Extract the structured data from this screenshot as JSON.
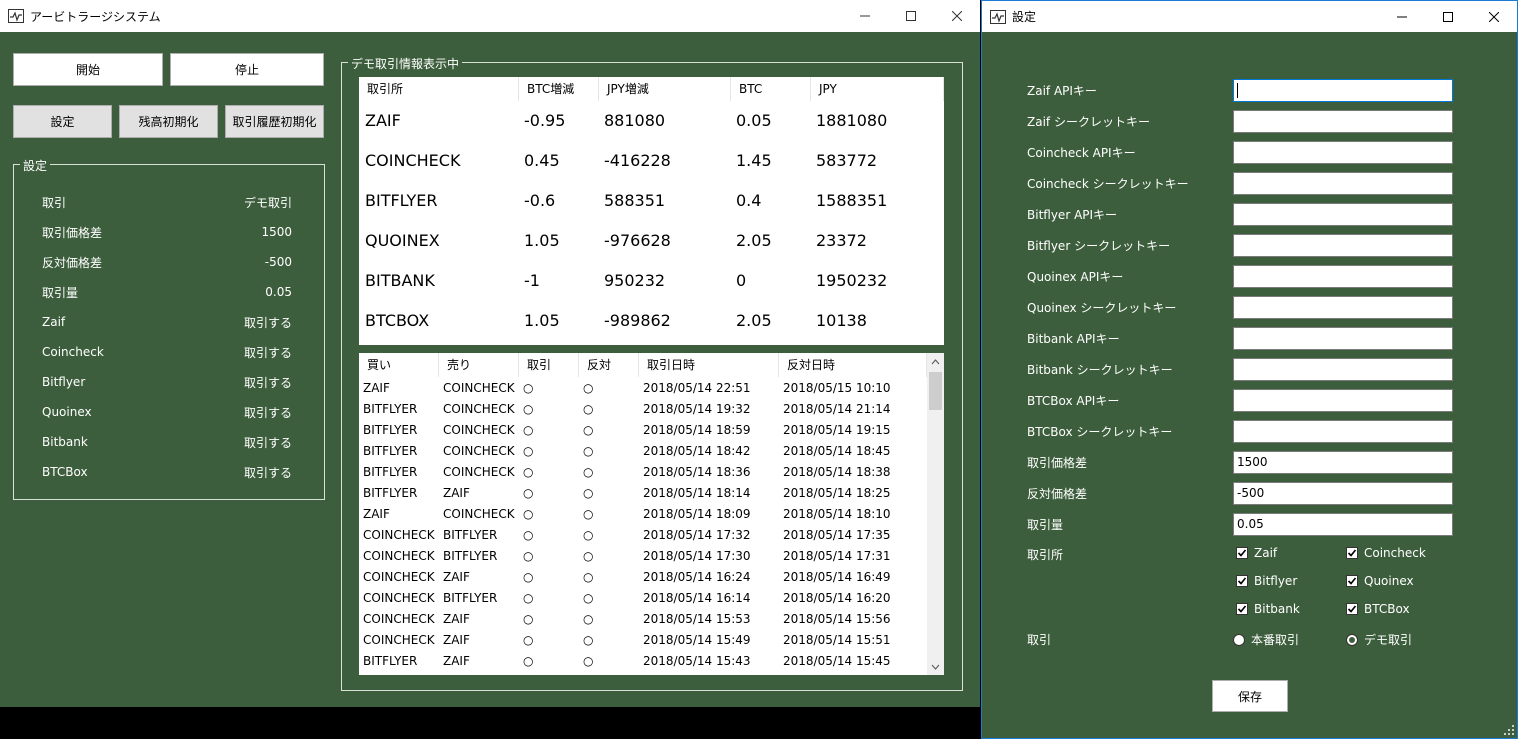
{
  "main_window": {
    "title": "アービトラージシステム",
    "buttons": {
      "start": "開始",
      "stop": "停止",
      "settings": "設定",
      "reset_balance": "残高初期化",
      "reset_history": "取引履歴初期化"
    },
    "settings_group": {
      "legend": "設定",
      "rows": [
        {
          "label": "取引",
          "value": "デモ取引"
        },
        {
          "label": "取引価格差",
          "value": "1500"
        },
        {
          "label": "反対価格差",
          "value": "-500"
        },
        {
          "label": "取引量",
          "value": "0.05"
        },
        {
          "label": "Zaif",
          "value": "取引する"
        },
        {
          "label": "Coincheck",
          "value": "取引する"
        },
        {
          "label": "Bitflyer",
          "value": "取引する"
        },
        {
          "label": "Quoinex",
          "value": "取引する"
        },
        {
          "label": "Bitbank",
          "value": "取引する"
        },
        {
          "label": "BTCBox",
          "value": "取引する"
        }
      ]
    },
    "info_group": {
      "legend": "デモ取引情報表示中",
      "exchange_headers": [
        "取引所",
        "BTC増減",
        "JPY増減",
        "BTC",
        "JPY"
      ],
      "exchange_rows": [
        [
          "ZAIF",
          "-0.95",
          "881080",
          "0.05",
          "1881080"
        ],
        [
          "COINCHECK",
          "0.45",
          "-416228",
          "1.45",
          "583772"
        ],
        [
          "BITFLYER",
          "-0.6",
          "588351",
          "0.4",
          "1588351"
        ],
        [
          "QUOINEX",
          "1.05",
          "-976628",
          "2.05",
          "23372"
        ],
        [
          "BITBANK",
          "-1",
          "950232",
          "0",
          "1950232"
        ],
        [
          "BTCBOX",
          "1.05",
          "-989862",
          "2.05",
          "10138"
        ]
      ],
      "history_headers": [
        "買い",
        "売り",
        "取引",
        "反対",
        "取引日時",
        "反対日時"
      ],
      "history_rows": [
        [
          "ZAIF",
          "COINCHECK",
          "○",
          "○",
          "2018/05/14 22:51",
          "2018/05/15 10:10"
        ],
        [
          "BITFLYER",
          "COINCHECK",
          "○",
          "○",
          "2018/05/14 19:32",
          "2018/05/14 21:14"
        ],
        [
          "BITFLYER",
          "COINCHECK",
          "○",
          "○",
          "2018/05/14 18:59",
          "2018/05/14 19:15"
        ],
        [
          "BITFLYER",
          "COINCHECK",
          "○",
          "○",
          "2018/05/14 18:42",
          "2018/05/14 18:45"
        ],
        [
          "BITFLYER",
          "COINCHECK",
          "○",
          "○",
          "2018/05/14 18:36",
          "2018/05/14 18:38"
        ],
        [
          "BITFLYER",
          "ZAIF",
          "○",
          "○",
          "2018/05/14 18:14",
          "2018/05/14 18:25"
        ],
        [
          "ZAIF",
          "COINCHECK",
          "○",
          "○",
          "2018/05/14 18:09",
          "2018/05/14 18:10"
        ],
        [
          "COINCHECK",
          "BITFLYER",
          "○",
          "○",
          "2018/05/14 17:32",
          "2018/05/14 17:35"
        ],
        [
          "COINCHECK",
          "BITFLYER",
          "○",
          "○",
          "2018/05/14 17:30",
          "2018/05/14 17:31"
        ],
        [
          "COINCHECK",
          "ZAIF",
          "○",
          "○",
          "2018/05/14 16:24",
          "2018/05/14 16:49"
        ],
        [
          "COINCHECK",
          "BITFLYER",
          "○",
          "○",
          "2018/05/14 16:14",
          "2018/05/14 16:20"
        ],
        [
          "COINCHECK",
          "ZAIF",
          "○",
          "○",
          "2018/05/14 15:53",
          "2018/05/14 15:56"
        ],
        [
          "COINCHECK",
          "ZAIF",
          "○",
          "○",
          "2018/05/14 15:49",
          "2018/05/14 15:51"
        ],
        [
          "BITFLYER",
          "ZAIF",
          "○",
          "○",
          "2018/05/14 15:43",
          "2018/05/14 15:45"
        ]
      ]
    }
  },
  "settings_window": {
    "title": "設定",
    "fields": [
      {
        "label": "Zaif APIキー",
        "value": ""
      },
      {
        "label": "Zaif シークレットキー",
        "value": ""
      },
      {
        "label": "Coincheck APIキー",
        "value": ""
      },
      {
        "label": "Coincheck シークレットキー",
        "value": ""
      },
      {
        "label": "Bitflyer APIキー",
        "value": ""
      },
      {
        "label": "Bitflyer シークレットキー",
        "value": ""
      },
      {
        "label": "Quoinex APIキー",
        "value": ""
      },
      {
        "label": "Quoinex シークレットキー",
        "value": ""
      },
      {
        "label": "Bitbank APIキー",
        "value": ""
      },
      {
        "label": "Bitbank シークレットキー",
        "value": ""
      },
      {
        "label": "BTCBox APIキー",
        "value": ""
      },
      {
        "label": "BTCBox シークレットキー",
        "value": ""
      },
      {
        "label": "取引価格差",
        "value": "1500"
      },
      {
        "label": "反対価格差",
        "value": "-500"
      },
      {
        "label": "取引量",
        "value": "0.05"
      }
    ],
    "exchange_label": "取引所",
    "exchanges": [
      {
        "name": "Zaif",
        "checked": true
      },
      {
        "name": "Coincheck",
        "checked": true
      },
      {
        "name": "Bitflyer",
        "checked": true
      },
      {
        "name": "Quoinex",
        "checked": true
      },
      {
        "name": "Bitbank",
        "checked": true
      },
      {
        "name": "BTCBox",
        "checked": true
      }
    ],
    "trade_label": "取引",
    "trade_modes": [
      {
        "name": "本番取引",
        "selected": false
      },
      {
        "name": "デモ取引",
        "selected": true
      }
    ],
    "save_label": "保存"
  },
  "colors": {
    "window_bg": "#3d5e3d",
    "accent": "#0078d7"
  }
}
